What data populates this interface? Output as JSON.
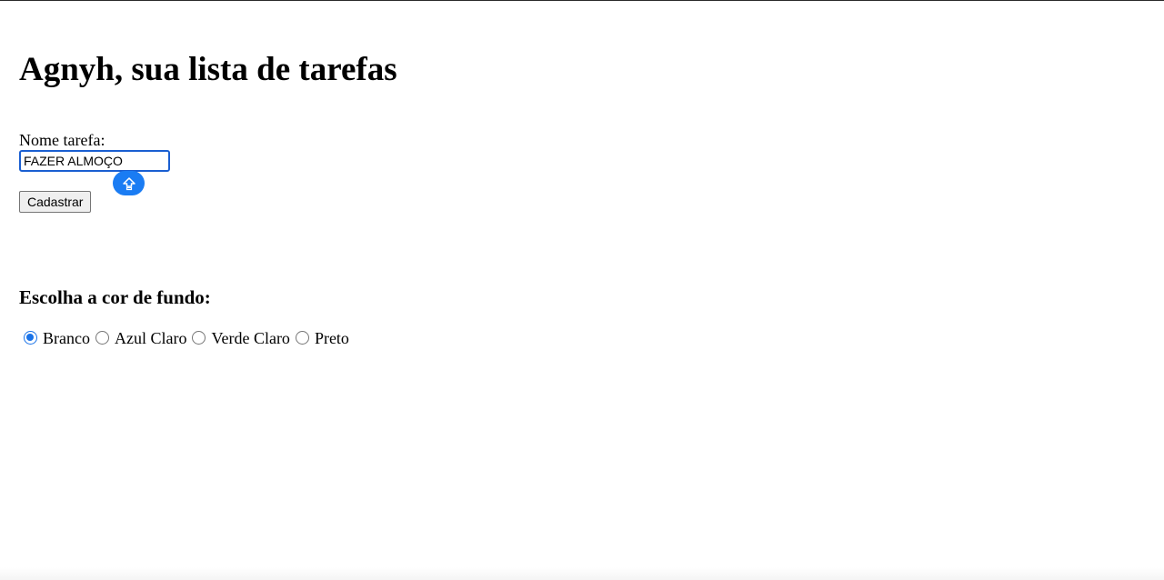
{
  "header": {
    "title": "Agnyh, sua lista de tarefas"
  },
  "task_form": {
    "label": "Nome tarefa:",
    "input_value": "FAZER ALMOÇO",
    "submit_label": "Cadastrar",
    "keyboard_badge_icon": "shift-arrow-icon"
  },
  "background_picker": {
    "heading": "Escolha a cor de fundo:",
    "selected": "Branco",
    "options": [
      {
        "label": "Branco",
        "checked": true
      },
      {
        "label": "Azul Claro",
        "checked": false
      },
      {
        "label": "Verde Claro",
        "checked": false
      },
      {
        "label": "Preto",
        "checked": false
      }
    ]
  },
  "colors": {
    "accent": "#1a73e8",
    "input_focus": "#1a5fd1",
    "badge": "#1a7cf3"
  }
}
